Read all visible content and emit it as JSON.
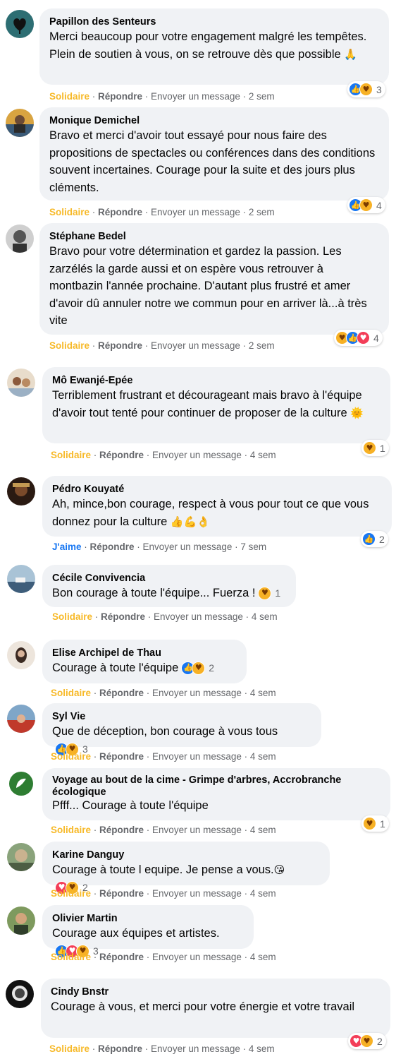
{
  "colors": {
    "bubble": "#f0f2f5",
    "solidaire": "#f7b928",
    "like": "#1877f2",
    "meta": "#65676b"
  },
  "icons": {
    "like": "like-reaction-icon",
    "care": "care-reaction-icon",
    "love": "love-reaction-icon"
  },
  "actions": {
    "reply": "Répondre",
    "message": "Envoyer un message",
    "sep": " · "
  },
  "comments": [
    {
      "author": "Papillon des Senteurs",
      "text": "Merci beaucoup pour votre engagement malgré les tempêtes. Plein de soutien à vous, on se retrouve dès que possible",
      "emoji": "🙏",
      "react_label": "Solidaire",
      "time": "2 sem",
      "reactions": [
        "like",
        "care"
      ],
      "count": "3"
    },
    {
      "author": "Monique Demichel",
      "text": "Bravo et merci d'avoir tout essayé pour nous faire des propositions de spectacles ou conférences dans des conditions souvent incertaines. Courage pour la suite et des jours plus cléments.",
      "emoji": "",
      "react_label": "Solidaire",
      "time": "2 sem",
      "reactions": [
        "like",
        "care"
      ],
      "count": "4"
    },
    {
      "author": "Stéphane Bedel",
      "text": "Bravo pour votre détermination et gardez la passion. Les zarzélés la garde aussi et on espère vous retrouver à montbazin l'année prochaine. D'autant plus frustré et amer d'avoir dû annuler notre we commun pour en arriver là...à très vite",
      "emoji": "",
      "react_label": "Solidaire",
      "time": "2 sem",
      "reactions": [
        "care",
        "like",
        "love"
      ],
      "count": "4"
    },
    {
      "author": "Mô Ewanjé-Epée",
      "text": "Terriblement frustrant et décourageant mais bravo à l'équipe d'avoir tout tenté pour continuer de proposer de la culture",
      "emoji": "🌞",
      "react_label": "Solidaire",
      "time": "4 sem",
      "reactions": [
        "care"
      ],
      "count": "1"
    },
    {
      "author": "Pédro Kouyaté",
      "text": "Ah, mince,bon courage, respect à vous pour tout ce que vous donnez pour la culture",
      "emoji": "👍💪👌",
      "react_label": "J'aime",
      "time": "7 sem",
      "reactions": [
        "like"
      ],
      "count": "2"
    },
    {
      "author": "Cécile Convivencia",
      "text": "Bon courage à toute l'équipe... Fuerza !",
      "emoji": "",
      "react_label": "Solidaire",
      "time": "4 sem",
      "reactions": [
        "care"
      ],
      "count": "1"
    },
    {
      "author": "Elise Archipel de Thau",
      "text": "Courage à toute l'équipe",
      "emoji": "",
      "react_label": "Solidaire",
      "time": "4 sem",
      "reactions": [
        "like",
        "care"
      ],
      "count": "2"
    },
    {
      "author": "Syl Vie",
      "text": "Que de déception, bon courage à vous tous",
      "emoji": "",
      "react_label": "Solidaire",
      "time": "4 sem",
      "reactions": [
        "like",
        "care"
      ],
      "count": "3"
    },
    {
      "author": "Voyage au bout de la cime - Grimpe d'arbres, Accrobranche écologique",
      "text": "Pfff... Courage à toute l'équipe",
      "emoji": "",
      "react_label": "Solidaire",
      "time": "4 sem",
      "reactions": [
        "care"
      ],
      "count": "1"
    },
    {
      "author": "Karine Danguy",
      "text": "Courage à toute l equipe. Je pense a vous.",
      "emoji": "😘",
      "react_label": "Solidaire",
      "time": "4 sem",
      "reactions": [
        "love",
        "care"
      ],
      "count": "2"
    },
    {
      "author": "Olivier Martin",
      "text": "Courage aux équipes et artistes.",
      "emoji": "",
      "react_label": "Solidaire",
      "time": "4 sem",
      "reactions": [
        "like",
        "love",
        "care"
      ],
      "count": "3"
    },
    {
      "author": "Cindy Bnstr",
      "text": "Courage à vous, et merci pour votre énergie et votre travail",
      "emoji": "",
      "react_label": "Solidaire",
      "time": "4 sem",
      "reactions": [
        "love",
        "care"
      ],
      "count": "2"
    }
  ]
}
